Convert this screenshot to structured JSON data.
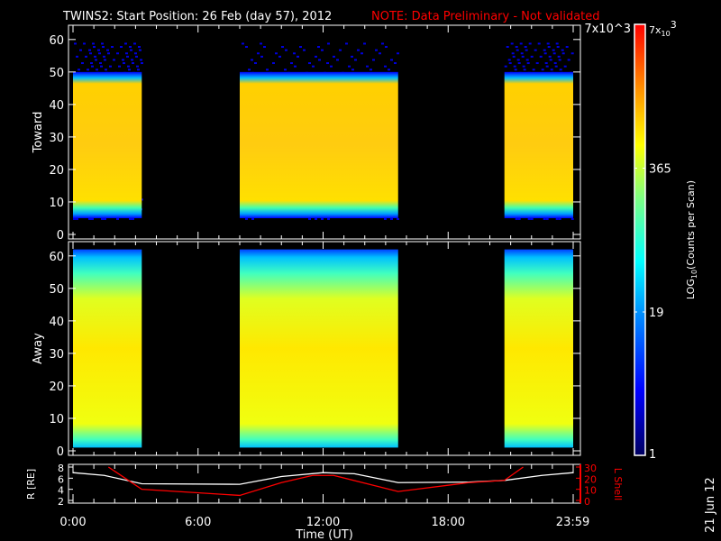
{
  "title": {
    "main": "TWINS2: Start Position: 26 Feb (day  57), 2012",
    "note": "NOTE: Data Preliminary - Not validated"
  },
  "footer_date": "21 Jun 12",
  "colors": {
    "accent_red": "#ff0000",
    "frame": "#ffffff",
    "background": "#000000"
  },
  "chart_data": [
    {
      "type": "heatmap",
      "panel": "toward",
      "ylabel": "Toward",
      "ylim": [
        0,
        63
      ],
      "yticks": [
        "0",
        "10",
        "20",
        "30",
        "40",
        "50",
        "60"
      ],
      "active_intervals_hours": [
        [
          0,
          3.3
        ],
        [
          8.0,
          15.6
        ],
        [
          20.7,
          24
        ]
      ],
      "band": {
        "core_low": 13,
        "core_high": 48,
        "edge_low": 5,
        "edge_high": 50,
        "sparse_high": 60
      }
    },
    {
      "type": "heatmap",
      "panel": "away",
      "ylabel": "Away",
      "ylim": [
        0,
        63
      ],
      "yticks": [
        "0",
        "10",
        "20",
        "30",
        "40",
        "50",
        "60"
      ],
      "active_intervals_hours": [
        [
          0,
          3.3
        ],
        [
          8.0,
          15.6
        ],
        [
          20.7,
          24
        ]
      ],
      "band": {
        "core_low": 3,
        "core_high": 55,
        "edge_low": 1,
        "edge_high": 62
      }
    },
    {
      "type": "line",
      "panel": "orbit",
      "xlabel": "Time (UT)",
      "xticks": [
        "0:00",
        "6:00",
        "12:00",
        "18:00",
        "23:59"
      ],
      "xtick_hours": [
        0,
        6,
        12,
        18,
        23.98
      ],
      "ylabel_left": "R [RE]",
      "ylim_left": [
        2,
        8
      ],
      "yticks_left": [
        "2",
        "4",
        "6",
        "8"
      ],
      "ylabel_right": "L Shell",
      "ylim_right": [
        0,
        30
      ],
      "yticks_right": [
        "0",
        "10",
        "20",
        "30"
      ],
      "series": [
        {
          "name": "R",
          "color": "#ffffff",
          "x": [
            0,
            1.5,
            3.3,
            8.0,
            10,
            12,
            13.5,
            15.6,
            19,
            20.7,
            22.5,
            24
          ],
          "y": [
            7.0,
            6.5,
            5.0,
            4.9,
            6.3,
            7.0,
            6.8,
            5.2,
            5.3,
            5.6,
            6.5,
            7.0
          ]
        },
        {
          "name": "L Shell",
          "color": "#ff0000",
          "x": [
            1.7,
            3.3,
            8.0,
            10,
            11.5,
            12.5,
            15.6,
            19,
            20.7,
            21.6
          ],
          "y": [
            30,
            10,
            4.5,
            16,
            22.5,
            22.5,
            8,
            16,
            18,
            30
          ]
        }
      ]
    },
    {
      "type": "colorbar",
      "label": "LOG10(Counts per Scan)",
      "label_base": "LOG",
      "label_sub": "10",
      "label_rest": "(Counts per Scan)",
      "tick_labels": [
        "1",
        "19",
        "365",
        "7x10^3"
      ],
      "tick_values": [
        1,
        19,
        365,
        7000
      ],
      "top_label_base": "7x",
      "top_label_sub": "10",
      "top_label_sup": "3"
    }
  ]
}
